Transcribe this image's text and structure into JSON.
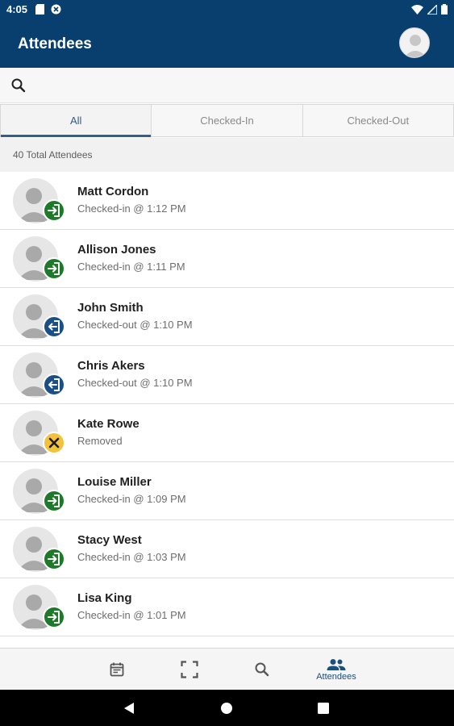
{
  "status_bar": {
    "time": "4:05",
    "left_icons": [
      "sd-card-icon",
      "sync-icon"
    ],
    "right_icons": [
      "wifi-icon",
      "signal-icon",
      "battery-icon"
    ]
  },
  "app_bar": {
    "title": "Attendees",
    "background_color": "#083f6e",
    "profile_icon": "avatar"
  },
  "search": {
    "icon": "search-icon",
    "placeholder": "",
    "value": ""
  },
  "tabs": [
    {
      "label": "All",
      "active": true
    },
    {
      "label": "Checked-In",
      "active": false
    },
    {
      "label": "Checked-Out",
      "active": false
    }
  ],
  "summary": {
    "total_label": "40 Total Attendees"
  },
  "status_colors": {
    "checked_in": "#1e7a2a",
    "checked_out": "#1b4f87",
    "removed": "#f2c33a"
  },
  "attendees": [
    {
      "name": "Matt Cordon",
      "status": "Checked-in @ 1:12 PM",
      "state": "checked_in"
    },
    {
      "name": "Allison Jones",
      "status": "Checked-in @ 1:11 PM",
      "state": "checked_in"
    },
    {
      "name": "John Smith",
      "status": "Checked-out @ 1:10 PM",
      "state": "checked_out"
    },
    {
      "name": "Chris Akers",
      "status": "Checked-out @ 1:10 PM",
      "state": "checked_out"
    },
    {
      "name": "Kate Rowe",
      "status": "Removed",
      "state": "removed"
    },
    {
      "name": "Louise Miller",
      "status": "Checked-in @ 1:09 PM",
      "state": "checked_in"
    },
    {
      "name": "Stacy West",
      "status": "Checked-in @ 1:03 PM",
      "state": "checked_in"
    },
    {
      "name": "Lisa King",
      "status": "Checked-in @ 1:01 PM",
      "state": "checked_in"
    }
  ],
  "bottom_nav": [
    {
      "icon": "calendar-icon",
      "label": "",
      "active": false
    },
    {
      "icon": "scan-icon",
      "label": "",
      "active": false
    },
    {
      "icon": "search-icon",
      "label": "",
      "active": false
    },
    {
      "icon": "people-icon",
      "label": "Attendees",
      "active": true
    }
  ],
  "system_nav": [
    "back-icon",
    "home-icon",
    "recents-icon"
  ]
}
